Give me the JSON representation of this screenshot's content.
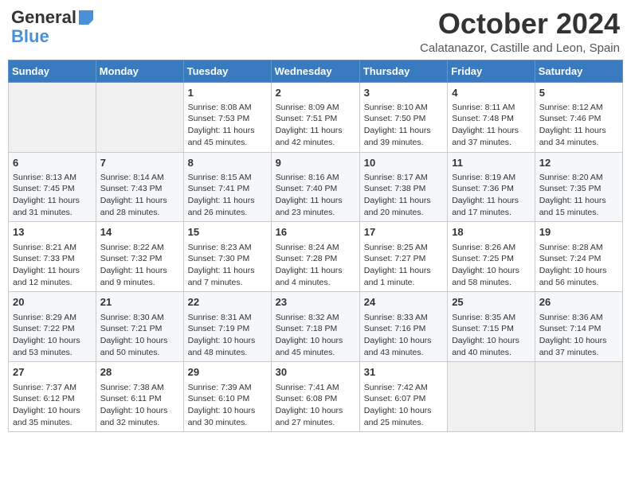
{
  "header": {
    "logo_general": "General",
    "logo_blue": "Blue",
    "month_title": "October 2024",
    "subtitle": "Calatanazor, Castille and Leon, Spain"
  },
  "days_of_week": [
    "Sunday",
    "Monday",
    "Tuesday",
    "Wednesday",
    "Thursday",
    "Friday",
    "Saturday"
  ],
  "weeks": [
    [
      {
        "day": "",
        "info": ""
      },
      {
        "day": "",
        "info": ""
      },
      {
        "day": "1",
        "info": "Sunrise: 8:08 AM\nSunset: 7:53 PM\nDaylight: 11 hours and 45 minutes."
      },
      {
        "day": "2",
        "info": "Sunrise: 8:09 AM\nSunset: 7:51 PM\nDaylight: 11 hours and 42 minutes."
      },
      {
        "day": "3",
        "info": "Sunrise: 8:10 AM\nSunset: 7:50 PM\nDaylight: 11 hours and 39 minutes."
      },
      {
        "day": "4",
        "info": "Sunrise: 8:11 AM\nSunset: 7:48 PM\nDaylight: 11 hours and 37 minutes."
      },
      {
        "day": "5",
        "info": "Sunrise: 8:12 AM\nSunset: 7:46 PM\nDaylight: 11 hours and 34 minutes."
      }
    ],
    [
      {
        "day": "6",
        "info": "Sunrise: 8:13 AM\nSunset: 7:45 PM\nDaylight: 11 hours and 31 minutes."
      },
      {
        "day": "7",
        "info": "Sunrise: 8:14 AM\nSunset: 7:43 PM\nDaylight: 11 hours and 28 minutes."
      },
      {
        "day": "8",
        "info": "Sunrise: 8:15 AM\nSunset: 7:41 PM\nDaylight: 11 hours and 26 minutes."
      },
      {
        "day": "9",
        "info": "Sunrise: 8:16 AM\nSunset: 7:40 PM\nDaylight: 11 hours and 23 minutes."
      },
      {
        "day": "10",
        "info": "Sunrise: 8:17 AM\nSunset: 7:38 PM\nDaylight: 11 hours and 20 minutes."
      },
      {
        "day": "11",
        "info": "Sunrise: 8:19 AM\nSunset: 7:36 PM\nDaylight: 11 hours and 17 minutes."
      },
      {
        "day": "12",
        "info": "Sunrise: 8:20 AM\nSunset: 7:35 PM\nDaylight: 11 hours and 15 minutes."
      }
    ],
    [
      {
        "day": "13",
        "info": "Sunrise: 8:21 AM\nSunset: 7:33 PM\nDaylight: 11 hours and 12 minutes."
      },
      {
        "day": "14",
        "info": "Sunrise: 8:22 AM\nSunset: 7:32 PM\nDaylight: 11 hours and 9 minutes."
      },
      {
        "day": "15",
        "info": "Sunrise: 8:23 AM\nSunset: 7:30 PM\nDaylight: 11 hours and 7 minutes."
      },
      {
        "day": "16",
        "info": "Sunrise: 8:24 AM\nSunset: 7:28 PM\nDaylight: 11 hours and 4 minutes."
      },
      {
        "day": "17",
        "info": "Sunrise: 8:25 AM\nSunset: 7:27 PM\nDaylight: 11 hours and 1 minute."
      },
      {
        "day": "18",
        "info": "Sunrise: 8:26 AM\nSunset: 7:25 PM\nDaylight: 10 hours and 58 minutes."
      },
      {
        "day": "19",
        "info": "Sunrise: 8:28 AM\nSunset: 7:24 PM\nDaylight: 10 hours and 56 minutes."
      }
    ],
    [
      {
        "day": "20",
        "info": "Sunrise: 8:29 AM\nSunset: 7:22 PM\nDaylight: 10 hours and 53 minutes."
      },
      {
        "day": "21",
        "info": "Sunrise: 8:30 AM\nSunset: 7:21 PM\nDaylight: 10 hours and 50 minutes."
      },
      {
        "day": "22",
        "info": "Sunrise: 8:31 AM\nSunset: 7:19 PM\nDaylight: 10 hours and 48 minutes."
      },
      {
        "day": "23",
        "info": "Sunrise: 8:32 AM\nSunset: 7:18 PM\nDaylight: 10 hours and 45 minutes."
      },
      {
        "day": "24",
        "info": "Sunrise: 8:33 AM\nSunset: 7:16 PM\nDaylight: 10 hours and 43 minutes."
      },
      {
        "day": "25",
        "info": "Sunrise: 8:35 AM\nSunset: 7:15 PM\nDaylight: 10 hours and 40 minutes."
      },
      {
        "day": "26",
        "info": "Sunrise: 8:36 AM\nSunset: 7:14 PM\nDaylight: 10 hours and 37 minutes."
      }
    ],
    [
      {
        "day": "27",
        "info": "Sunrise: 7:37 AM\nSunset: 6:12 PM\nDaylight: 10 hours and 35 minutes."
      },
      {
        "day": "28",
        "info": "Sunrise: 7:38 AM\nSunset: 6:11 PM\nDaylight: 10 hours and 32 minutes."
      },
      {
        "day": "29",
        "info": "Sunrise: 7:39 AM\nSunset: 6:10 PM\nDaylight: 10 hours and 30 minutes."
      },
      {
        "day": "30",
        "info": "Sunrise: 7:41 AM\nSunset: 6:08 PM\nDaylight: 10 hours and 27 minutes."
      },
      {
        "day": "31",
        "info": "Sunrise: 7:42 AM\nSunset: 6:07 PM\nDaylight: 10 hours and 25 minutes."
      },
      {
        "day": "",
        "info": ""
      },
      {
        "day": "",
        "info": ""
      }
    ]
  ]
}
